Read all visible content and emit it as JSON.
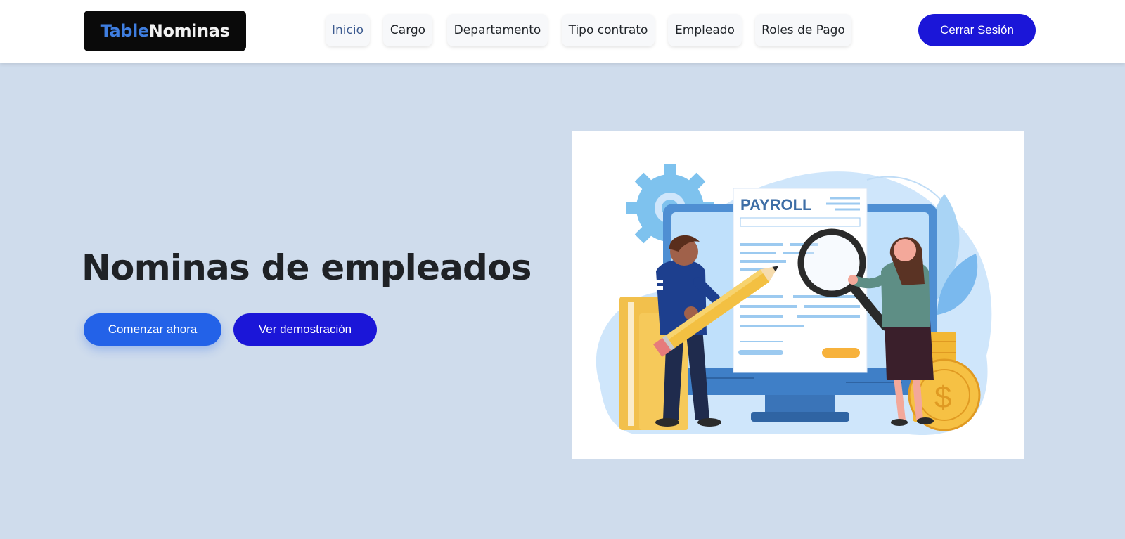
{
  "brand": {
    "part1": "Table",
    "part2": "Nominas"
  },
  "nav": {
    "items": [
      {
        "label": "Inicio",
        "active": true
      },
      {
        "label": "Cargo",
        "active": false
      },
      {
        "label": "Departamento",
        "active": false
      },
      {
        "label": "Tipo contrato",
        "active": false
      },
      {
        "label": "Empleado",
        "active": false
      },
      {
        "label": "Roles de Pago",
        "active": false
      }
    ],
    "logout_label": "Cerrar Sesión"
  },
  "hero": {
    "title": "Nominas de empleados",
    "primary_button": "Comenzar ahora",
    "secondary_button": "Ver demostración"
  },
  "illustration": {
    "document_title": "PAYROLL",
    "currency_symbol": "$"
  },
  "colors": {
    "page_background": "#cfdcec",
    "brand_accent": "#3f7ee0",
    "primary_button": "#2362e8",
    "secondary_button": "#1b16d8"
  }
}
